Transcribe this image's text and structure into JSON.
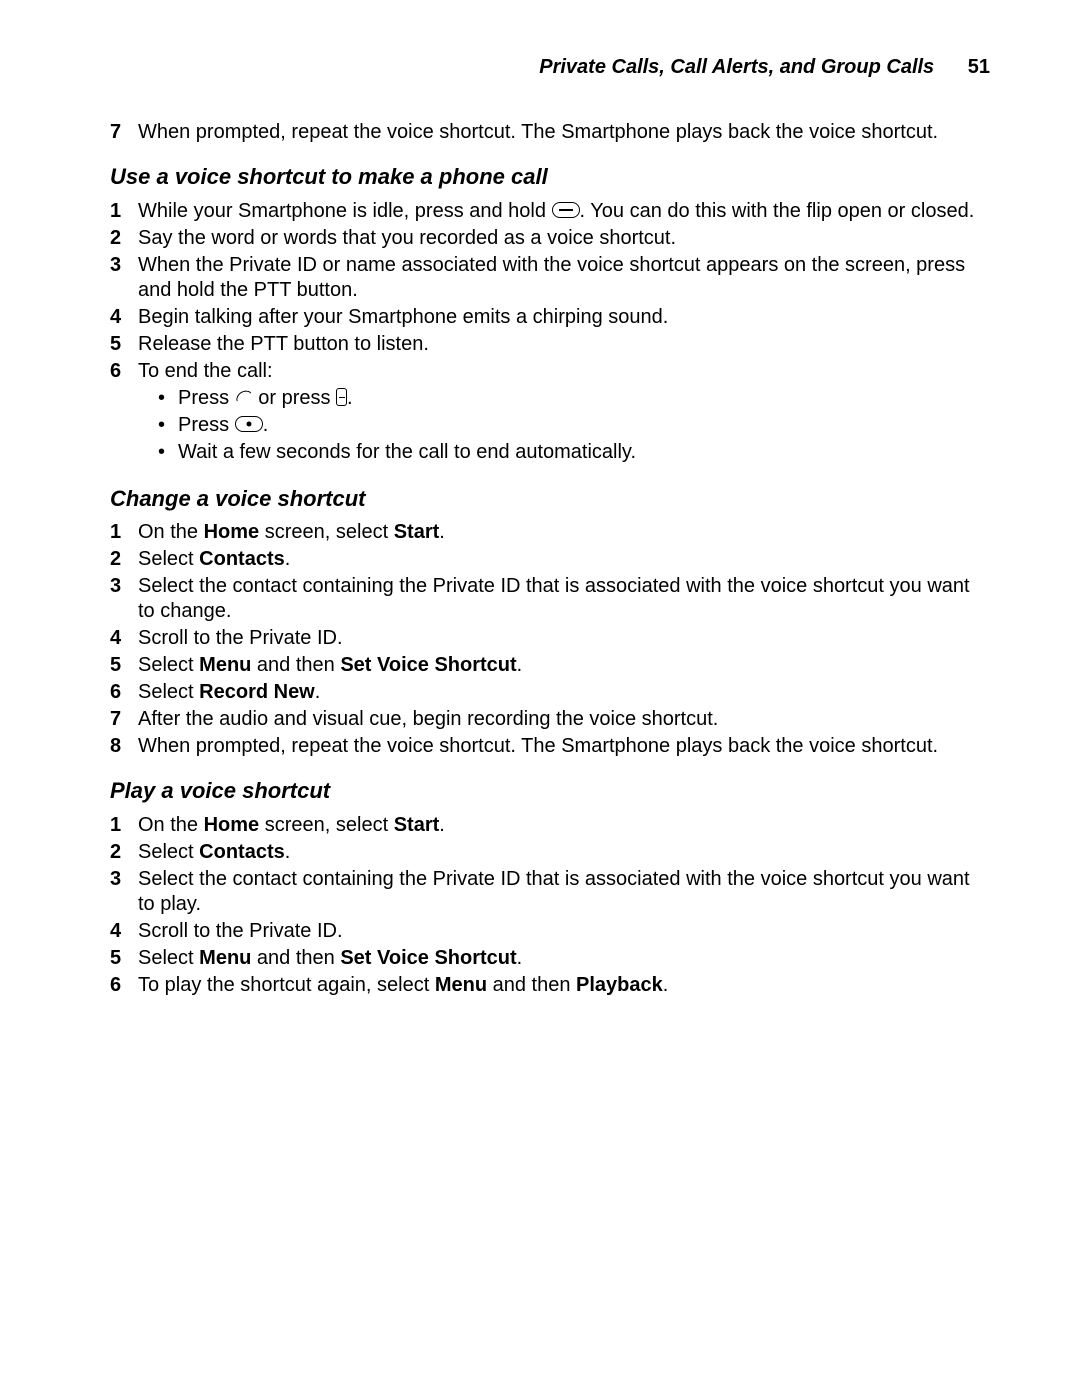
{
  "header": {
    "title": "Private Calls, Call Alerts, and Group Calls",
    "page": "51"
  },
  "intro_step": {
    "num": "7",
    "text": "When prompted, repeat the voice shortcut. The Smartphone plays back the voice shortcut."
  },
  "sections": [
    {
      "title": "Use a voice shortcut to make a phone call",
      "steps": [
        {
          "num": "1",
          "pre": "While your Smartphone is idle, press and hold ",
          "icon": "speaker-oval",
          "post": ". You can do this with the flip open or closed."
        },
        {
          "num": "2",
          "text": "Say the word or words that you recorded as a voice shortcut."
        },
        {
          "num": "3",
          "text": "When the Private ID or name associated with the voice shortcut appears on the screen, press and hold the PTT button."
        },
        {
          "num": "4",
          "text": "Begin talking after your Smartphone emits a chirping sound."
        },
        {
          "num": "5",
          "text": "Release the PTT button to listen."
        },
        {
          "num": "6",
          "text": "To end the call:",
          "bullets": [
            {
              "kind": "end-press",
              "t1": "Press ",
              "mid": " or press ",
              "t3": "."
            },
            {
              "kind": "power",
              "t1": "Press ",
              "t3": "."
            },
            {
              "kind": "plain",
              "text": "Wait a few seconds for the call to end automatically."
            }
          ]
        }
      ]
    },
    {
      "title": "Change a voice shortcut",
      "steps": [
        {
          "num": "1",
          "rich": [
            {
              "t": "On the "
            },
            {
              "b": "Home"
            },
            {
              "t": " screen, select "
            },
            {
              "b": "Start"
            },
            {
              "t": "."
            }
          ]
        },
        {
          "num": "2",
          "rich": [
            {
              "t": "Select "
            },
            {
              "b": "Contacts"
            },
            {
              "t": "."
            }
          ]
        },
        {
          "num": "3",
          "text": "Select the contact containing the Private ID that is associated with the voice shortcut you want to change."
        },
        {
          "num": "4",
          "text": "Scroll to the Private ID."
        },
        {
          "num": "5",
          "rich": [
            {
              "t": "Select "
            },
            {
              "b": "Menu"
            },
            {
              "t": " and then "
            },
            {
              "b": "Set Voice Shortcut"
            },
            {
              "t": "."
            }
          ]
        },
        {
          "num": "6",
          "rich": [
            {
              "t": "Select "
            },
            {
              "b": "Record New"
            },
            {
              "t": "."
            }
          ]
        },
        {
          "num": "7",
          "text": "After the audio and visual cue, begin recording the voice shortcut."
        },
        {
          "num": "8",
          "text": "When prompted, repeat the voice shortcut. The Smartphone plays back the voice shortcut."
        }
      ]
    },
    {
      "title": "Play a voice shortcut",
      "steps": [
        {
          "num": "1",
          "rich": [
            {
              "t": "On the "
            },
            {
              "b": "Home"
            },
            {
              "t": " screen, select "
            },
            {
              "b": "Start"
            },
            {
              "t": "."
            }
          ]
        },
        {
          "num": "2",
          "rich": [
            {
              "t": "Select "
            },
            {
              "b": "Contacts"
            },
            {
              "t": "."
            }
          ]
        },
        {
          "num": "3",
          "text": "Select the contact containing the Private ID that is associated with the voice shortcut you want to play."
        },
        {
          "num": "4",
          "text": "Scroll to the Private ID."
        },
        {
          "num": "5",
          "rich": [
            {
              "t": "Select "
            },
            {
              "b": "Menu"
            },
            {
              "t": " and then "
            },
            {
              "b": "Set Voice Shortcut"
            },
            {
              "t": "."
            }
          ]
        },
        {
          "num": "6",
          "rich": [
            {
              "t": "To play the shortcut again, select "
            },
            {
              "b": "Menu"
            },
            {
              "t": " and then "
            },
            {
              "b": "Playback"
            },
            {
              "t": "."
            }
          ]
        }
      ]
    }
  ]
}
